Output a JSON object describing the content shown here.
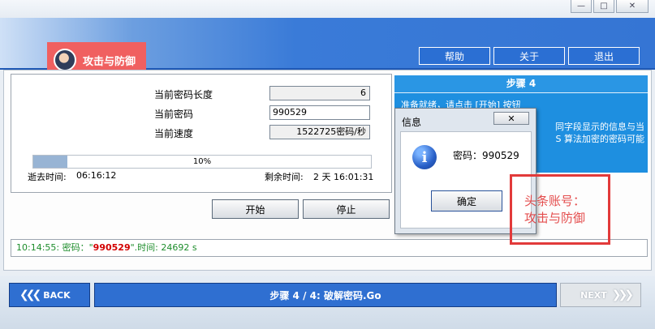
{
  "window": {
    "minimize": "—",
    "maximize": "□",
    "close": "✕"
  },
  "logo": {
    "text": "攻击与防御"
  },
  "topnav": [
    {
      "label": "帮助"
    },
    {
      "label": "关于"
    },
    {
      "label": "退出"
    }
  ],
  "form": {
    "length_label": "当前密码长度",
    "length_value": "6",
    "password_label": "当前密码",
    "password_value": "990529",
    "speed_label": "当前速度",
    "speed_value": "1522725密码/秒",
    "progress": {
      "percent": 10,
      "text": "10%"
    },
    "elapsed_label": "逝去时间:",
    "elapsed_value": "06:16:12",
    "remaining_label": "剩余时间:",
    "remaining_value": "2 天 16:01:31",
    "start_label": "开始",
    "stop_label": "停止"
  },
  "step_panel": {
    "title": "步骤 4",
    "line1": "准备就绪，请点击 [开始] 按钮",
    "line2a": "同字段显示的信息与当",
    "line2b": "S 算法加密的密码可能"
  },
  "log": {
    "prefix": "10:14:55: 密码：\"",
    "password": "990529",
    "suffix": "\".时间: 24692 s"
  },
  "dialog": {
    "title": "信息",
    "close": "✕",
    "icon_letter": "i",
    "message": "密码：990529",
    "ok_label": "确定"
  },
  "watermark": {
    "line1": "头条账号：",
    "line2": "攻击与防御"
  },
  "bottom": {
    "back_label": "BACK",
    "back_chevrons": "❮❮❮",
    "step_label": "步骤 4 / 4: 破解密码.Go",
    "next_label": "NEXT",
    "next_chevrons": "❯❯❯"
  }
}
